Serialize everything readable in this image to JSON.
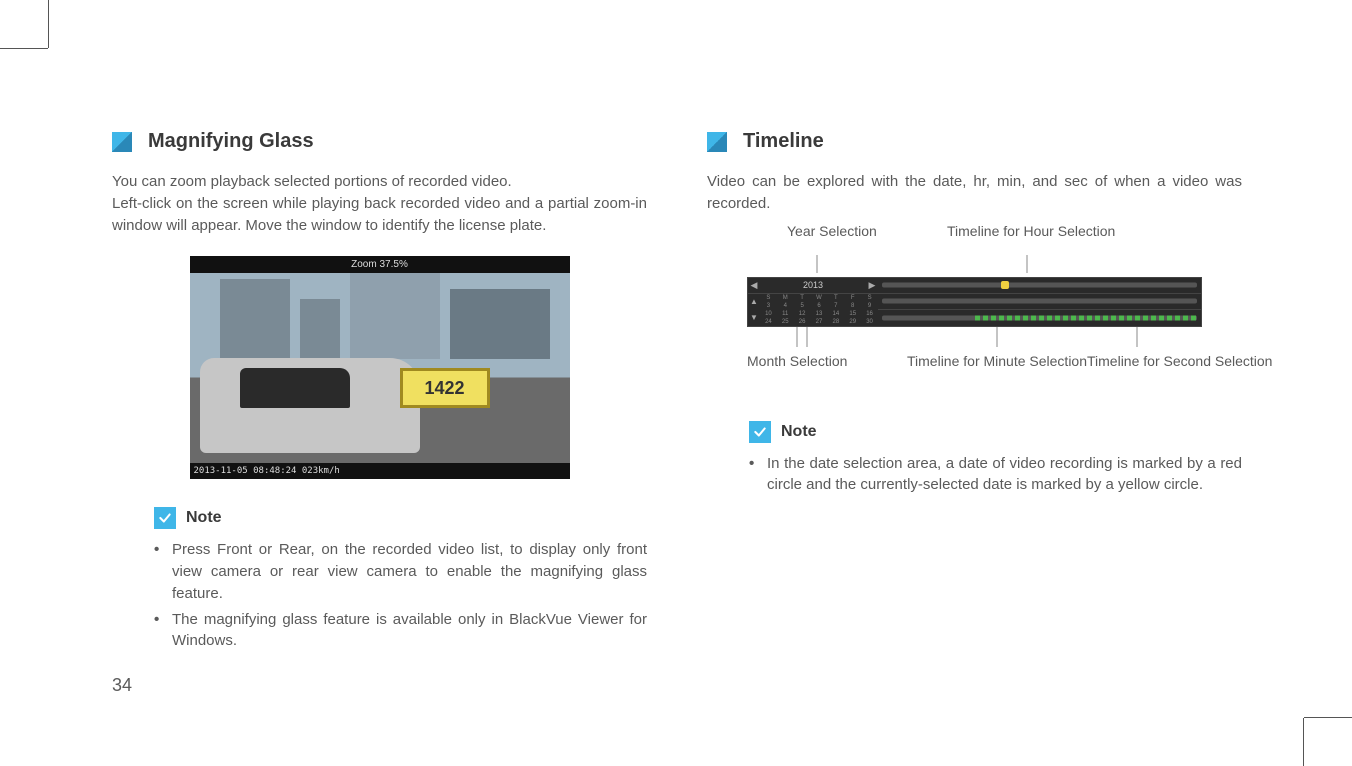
{
  "page_number": "34",
  "left": {
    "title": "Magnifying Glass",
    "p1": "You can zoom playback selected portions of recorded video.",
    "p2": "Left-click on the screen while playing back recorded video and a partial zoom-in window will appear. Move the window to identify the license plate.",
    "video": {
      "top_bar": "Zoom 37.5%",
      "plate": "1422",
      "foot": "2013-11-05 08:48:24  023km/h"
    },
    "note_title": "Note",
    "notes": [
      "Press Front or Rear, on the recorded video list, to display only front view camera or rear view camera to enable the magnifying glass feature.",
      "The magnifying glass feature is available only in BlackVue Viewer for Windows."
    ]
  },
  "right": {
    "title": "Timeline",
    "p1": "Video can be explored with the date, hr, min, and sec of when a video was recorded.",
    "labels": {
      "year": "Year Selection",
      "hour": "Timeline for Hour Selection",
      "month": "Month Selection",
      "minute": "Timeline for Minute Selection",
      "second": "Timeline for Second Selection"
    },
    "panel_year": "2013",
    "note_title": "Note",
    "notes": [
      "In the date selection area, a date of video recording is marked by a red circle and the currently-selected date is marked by a yellow circle."
    ]
  }
}
